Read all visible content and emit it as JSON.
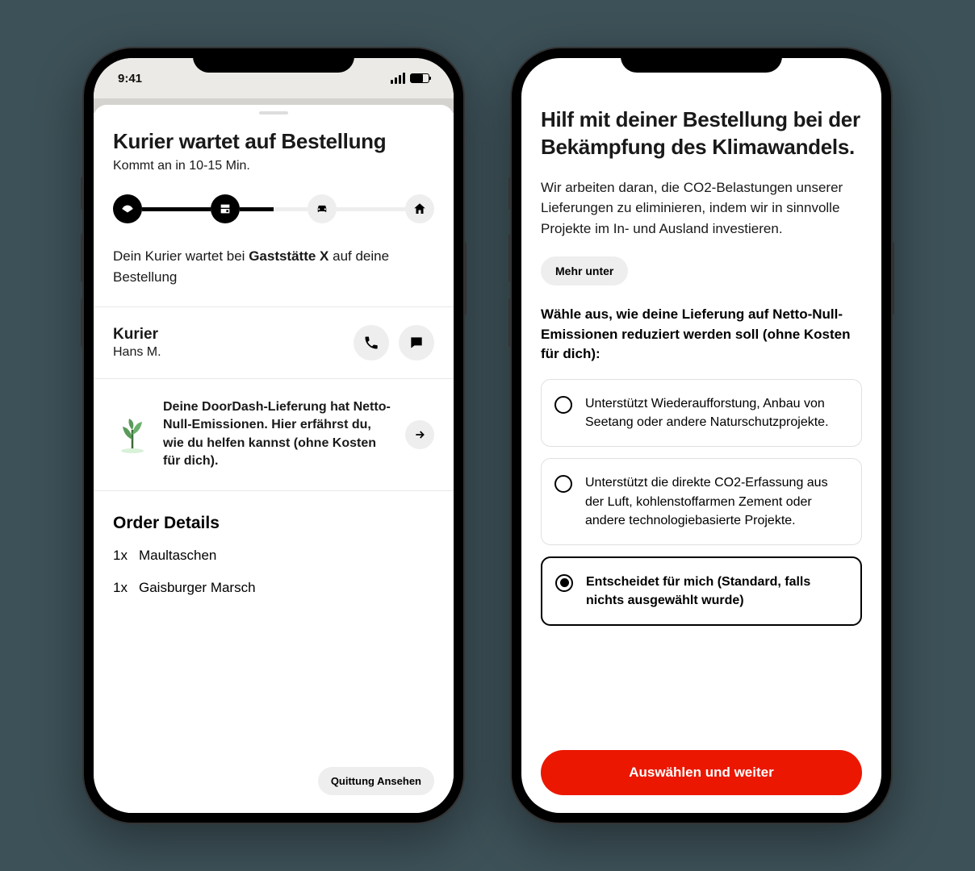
{
  "phone1": {
    "statusTime": "9:41",
    "title": "Kurier wartet auf Bestellung",
    "subtitle": "Kommt an in 10-15 Min.",
    "statusPrefix": "Dein Kurier wartet bei ",
    "statusBold": "Gaststätte X",
    "statusSuffix": " auf deine Bestellung",
    "courierLabel": "Kurier",
    "courierName": "Hans M.",
    "ecoText": "Deine DoorDash-Lieferung hat Netto-Null-Emissionen. Hier erfährst du, wie du helfen kannst (ohne Kosten für dich).",
    "orderTitle": "Order Details",
    "items": [
      {
        "qty": "1x",
        "name": "Maultaschen"
      },
      {
        "qty": "1x",
        "name": "Gaisburger Marsch"
      }
    ],
    "receiptBtn": "Quittung Ansehen"
  },
  "phone2": {
    "title": "Hilf mit deiner Bestellung bei der Bekämpfung des Klimawandels.",
    "body": "Wir arbeiten daran, die CO2-Belastungen unserer Lieferungen zu eliminieren, indem wir in sinnvolle Projekte im In- und Ausland investieren.",
    "moreBtn": "Mehr unter",
    "chooseLabel": "Wähle aus, wie deine Lieferung auf Netto-Null-Emissionen reduziert werden soll (ohne Kosten für dich):",
    "options": [
      {
        "text": "Unterstützt Wiederaufforstung, Anbau von Seetang oder andere Naturschutzprojekte.",
        "selected": false
      },
      {
        "text": "Unterstützt die direkte CO2-Erfassung aus der Luft, kohlenstoffarmen Zement oder andere technologiebasierte Projekte.",
        "selected": false
      },
      {
        "text": "Entscheidet für mich (Standard, falls nichts ausgewählt wurde)",
        "selected": true
      }
    ],
    "ctaBtn": "Auswählen und weiter"
  }
}
